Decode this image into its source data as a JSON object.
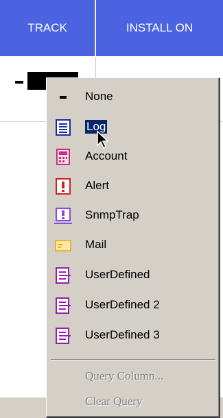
{
  "header": {
    "track_label": "TRACK",
    "install_label": "INSTALL ON"
  },
  "context_menu": {
    "items": [
      {
        "label": "None",
        "icon": "minus-icon"
      },
      {
        "label": "Log",
        "icon": "log-icon",
        "highlighted": true
      },
      {
        "label": "Account",
        "icon": "account-icon"
      },
      {
        "label": "Alert",
        "icon": "alert-icon"
      },
      {
        "label": "SnmpTrap",
        "icon": "snmptrap-icon"
      },
      {
        "label": "Mail",
        "icon": "mail-icon"
      },
      {
        "label": "UserDefined",
        "icon": "userdefined-icon"
      },
      {
        "label": "UserDefined 2",
        "icon": "userdefined-icon"
      },
      {
        "label": "UserDefined 3",
        "icon": "userdefined-icon"
      }
    ],
    "disabled_items": [
      "Query Column...",
      "Clear Query"
    ]
  },
  "colors": {
    "header_bg": "#4b63e1",
    "menu_bg": "#d4d0c8",
    "highlight": "#0a246a"
  }
}
